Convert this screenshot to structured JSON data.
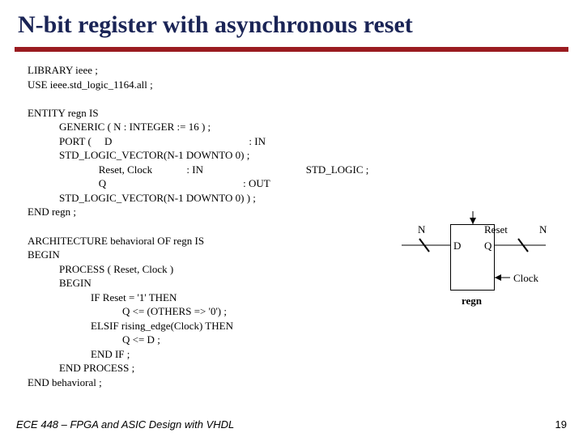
{
  "title": "N-bit register with asynchronous reset",
  "code": "LIBRARY ieee ;\nUSE ieee.std_logic_1164.all ;\n\nENTITY regn IS\n            GENERIC ( N : INTEGER := 16 ) ;\n            PORT (     D                                                    : IN\n            STD_LOGIC_VECTOR(N-1 DOWNTO 0) ;\n                           Reset, Clock             : IN                                       STD_LOGIC ;\n                           Q                                                    : OUT\n            STD_LOGIC_VECTOR(N-1 DOWNTO 0) ) ;\nEND regn ;\n\nARCHITECTURE behavioral OF regn IS\nBEGIN\n            PROCESS ( Reset, Clock )\n            BEGIN\n                        IF Reset = '1' THEN\n                                    Q <= (OTHERS => '0') ;\n                        ELSIF rising_edge(Clock) THEN\n                                    Q <= D ;\n                        END IF ;\n            END PROCESS ;\nEND behavioral ;",
  "diagram": {
    "n_left": "N",
    "n_right": "N",
    "reset": "Reset",
    "d": "D",
    "q": "Q",
    "clock": "Clock",
    "name": "regn"
  },
  "footer": {
    "left": "ECE 448 – FPGA and ASIC Design with VHDL",
    "page": "19"
  }
}
